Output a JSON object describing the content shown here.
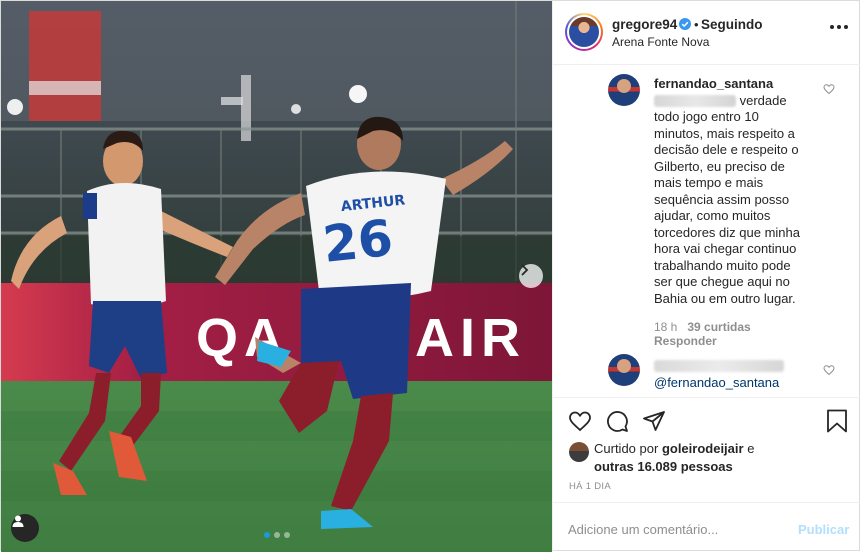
{
  "post": {
    "photo": {
      "sponsor_text": "QATAR AIRWAYS",
      "player_number": "26",
      "player_name": "ARTHUR"
    },
    "header": {
      "username": "gregore94",
      "verified": true,
      "separator": "•",
      "follow_status": "Seguindo",
      "location": "Arena Fonte Nova"
    },
    "comments": [
      {
        "username": "fernandao_santana",
        "text": "verdade\ntodo jogo entro 10\nminutos, mais respeito a\ndecisão dele e respeito o\nGilberto, eu preciso de\nmais tempo e mais\nsequência assim posso\najudar, como muitos\ntorcedores diz que minha\nhora vai chegar continuo\ntrabalhando muito pode\nser que chegue aqui no\nBahia ou em outro lugar.",
        "time": "18 h",
        "likes": "39 curtidas",
        "reply_label": "Responder"
      },
      {
        "mention": "@fernandao_santana"
      }
    ],
    "actions": {
      "liked_prefix": "Curtido por",
      "liked_user": "goleirodeijair",
      "liked_conj": "e",
      "liked_others": "outras 16.089 pessoas",
      "time_ago": "HÁ 1 DIA"
    },
    "add_comment": {
      "placeholder": "Adicione um comentário...",
      "publish_label": "Publicar"
    }
  },
  "colors": {
    "accent_link": "#00376b",
    "verified_blue": "#3897f0",
    "publish_disabled": "#b2dffc",
    "muted": "#8e8e8e"
  }
}
